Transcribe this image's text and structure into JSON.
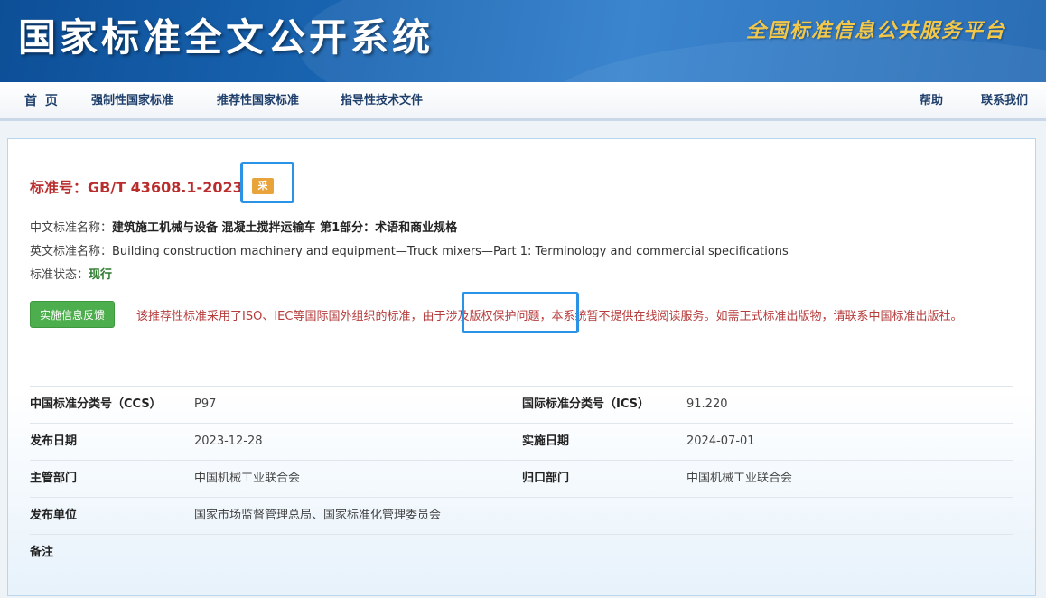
{
  "header": {
    "title": "国家标准全文公开系统",
    "platform": "全国标准信息公共服务平台"
  },
  "nav": {
    "home": "首 页",
    "mandatory": "强制性国家标准",
    "recommended": "推荐性国家标准",
    "guidance": "指导性技术文件",
    "help": "帮助",
    "contact": "联系我们"
  },
  "standard": {
    "title_label": "标准号：",
    "number": "GB/T 43608.1-2023",
    "badge": "采",
    "cn_name_label": "中文标准名称：",
    "cn_name": "建筑施工机械与设备 混凝土搅拌运输车 第1部分：术语和商业规格",
    "en_name_label": "英文标准名称：",
    "en_name": "Building construction machinery and equipment—Truck mixers—Part 1: Terminology and commercial specifications",
    "status_label": "标准状态：",
    "status": "现行"
  },
  "feedback_button": "实施信息反馈",
  "notice": "该推荐性标准采用了ISO、IEC等国际国外组织的标准，由于涉及版权保护问题，本系统暂不提供在线阅读服务。如需正式标准出版物，请联系中国标准出版社。",
  "info": {
    "ccs_label": "中国标准分类号（CCS）",
    "ccs": "P97",
    "ics_label": "国际标准分类号（ICS）",
    "ics": "91.220",
    "pub_date_label": "发布日期",
    "pub_date": "2023-12-28",
    "impl_date_label": "实施日期",
    "impl_date": "2024-07-01",
    "dept_label": "主管部门",
    "dept": "中国机械工业联合会",
    "tc_label": "归口部门",
    "tc": "中国机械工业联合会",
    "publisher_label": "发布单位",
    "publisher": "国家市场监督管理总局、国家标准化管理委员会",
    "remark_label": "备注",
    "remark": ""
  },
  "colors": {
    "banner": "#1a66b3",
    "title_red": "#b92d2d",
    "badge": "#e8a33a",
    "button_green": "#4cae4c",
    "highlight": "#2b93e6"
  }
}
